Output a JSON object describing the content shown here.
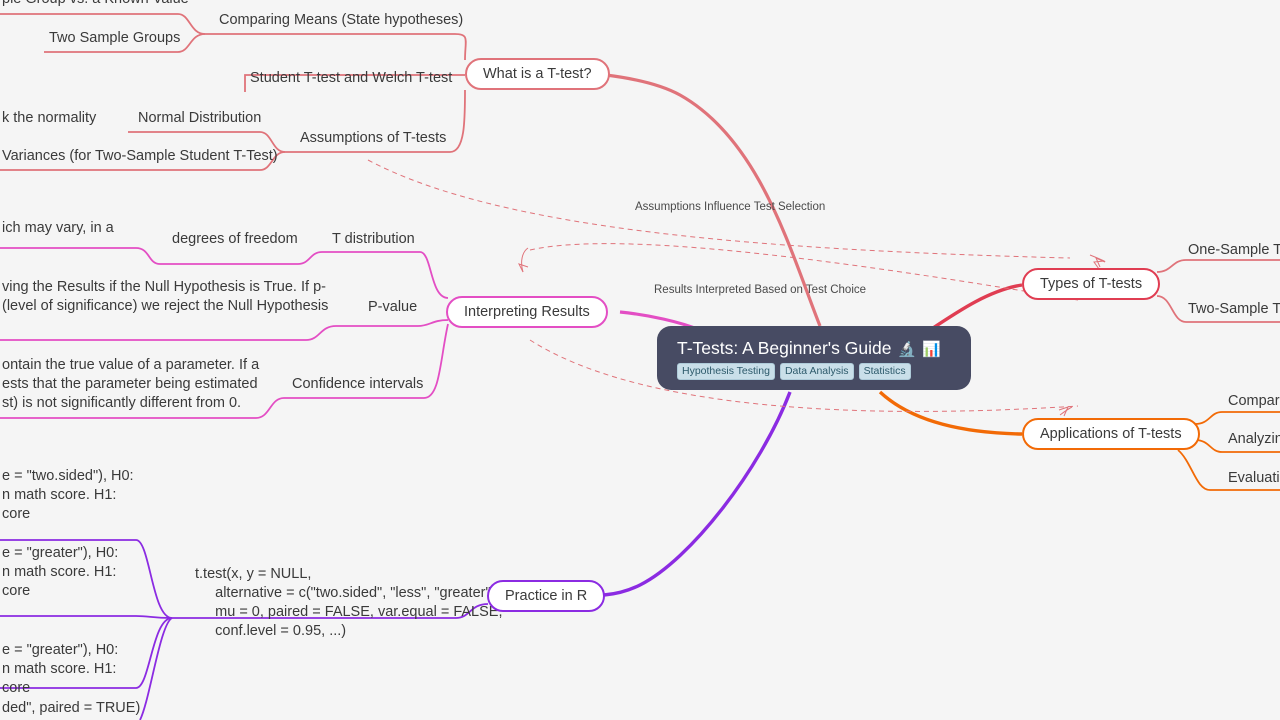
{
  "root": {
    "title": "T-Tests: A Beginner's Guide",
    "emojis": "🔬 📊",
    "tags": [
      "Hypothesis Testing",
      "Data Analysis",
      "Statistics"
    ]
  },
  "colors": {
    "background": "#f5f5f5",
    "root_fill": "#474b63",
    "branch_red": "#e0737a",
    "branch_crimson": "#e03d52",
    "branch_pink": "#e34ec4",
    "branch_orange": "#f26a06",
    "branch_purple": "#8b2be2",
    "tag_fill": "#c9dfe9",
    "tag_text": "#2d5a6b",
    "text": "#3a3a3a"
  },
  "branches": {
    "what_is_a_ttest": {
      "label": "What is a T-test?",
      "children": [
        {
          "label": "Comparing Means (State hypotheses)",
          "children": [
            "Two Sample Groups",
            "ple Group vs. a Known Value"
          ]
        },
        {
          "label": "Student T-test and Welch T-test",
          "children": []
        },
        {
          "label": "Assumptions of T-tests",
          "children": [
            "Normal Distribution",
            "k the normality",
            "Variances (for Two-Sample Student T-Test)"
          ]
        }
      ]
    },
    "interpreting_results": {
      "label": "Interpreting Results",
      "children": [
        {
          "label": "T distribution",
          "children": [
            "degrees of freedom",
            "ich may vary, in a"
          ]
        },
        {
          "label": "P-value",
          "children": [
            "ving the Results if the Null Hypothesis is True. If p-\n(level of significance) we reject the Null Hypothesis"
          ]
        },
        {
          "label": "Confidence intervals",
          "children": [
            "ontain the true value of a parameter. If a\nests that the parameter being estimated\nst) is not significantly different from 0."
          ]
        }
      ]
    },
    "practice_in_r": {
      "label": "Practice in R",
      "children": [
        {
          "label": "t.test(x, y = NULL,\n     alternative = c(\"two.sided\", \"less\", \"greater\"),\n     mu = 0, paired = FALSE, var.equal = FALSE,\n     conf.level = 0.95, ...)",
          "children": [
            "e = \"two.sided\"), H0:\nn math score. H1:\ncore",
            "e = \"greater\"), H0:\nn math score. H1:\ncore",
            "e = \"greater\"), H0:\nn math score. H1:\ncore",
            "ded\", paired = TRUE)"
          ]
        }
      ]
    },
    "types_of_ttests": {
      "label": "Types of T-tests",
      "children": [
        {
          "label": "One-Sample T-t",
          "children": []
        },
        {
          "label": "Two-Sample T-t",
          "children": []
        }
      ]
    },
    "applications_of_ttests": {
      "label": "Applications of T-tests",
      "children": [
        {
          "label": "Compari",
          "children": []
        },
        {
          "label": "Analyzin",
          "children": []
        },
        {
          "label": "Evaluatin",
          "children": []
        }
      ]
    }
  },
  "relationships": [
    {
      "label": "Assumptions Influence Test Selection"
    },
    {
      "label": "Results Interpreted Based on Test Choice"
    }
  ]
}
